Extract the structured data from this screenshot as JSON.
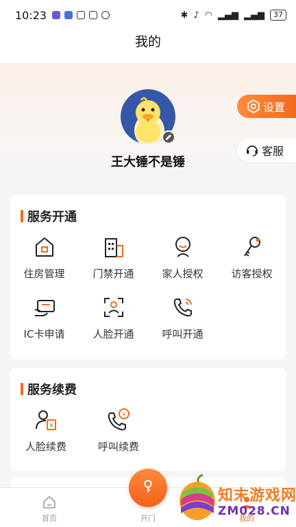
{
  "status_bar": {
    "time": "10:23",
    "battery": "37"
  },
  "nav": {
    "title": "我的"
  },
  "profile": {
    "username": "王大锤不是锤"
  },
  "side_buttons": {
    "settings": "设置",
    "service": "客服"
  },
  "service_section": {
    "title": "服务开通",
    "items": [
      {
        "label": "住房管理",
        "icon": "house-icon"
      },
      {
        "label": "门禁开通",
        "icon": "building-icon"
      },
      {
        "label": "家人授权",
        "icon": "person-smile-icon"
      },
      {
        "label": "访客授权",
        "icon": "key-icon"
      },
      {
        "label": "IC卡申请",
        "icon": "card-icon"
      },
      {
        "label": "人脸开通",
        "icon": "face-scan-icon"
      },
      {
        "label": "呼叫开通",
        "icon": "phone-icon"
      }
    ]
  },
  "renew_section": {
    "title": "服务续费",
    "items": [
      {
        "label": "人脸续费",
        "icon": "face-pay-icon"
      },
      {
        "label": "呼叫续费",
        "icon": "phone-pay-icon"
      }
    ]
  },
  "tabbar": {
    "home": "首页",
    "door": "开门",
    "mine": "我的"
  },
  "watermark": {
    "line1": "知末游戏网",
    "line2": "ZM028.CN"
  },
  "colors": {
    "accent": "#f26c1e",
    "avatar_bg": "#3558a8"
  }
}
